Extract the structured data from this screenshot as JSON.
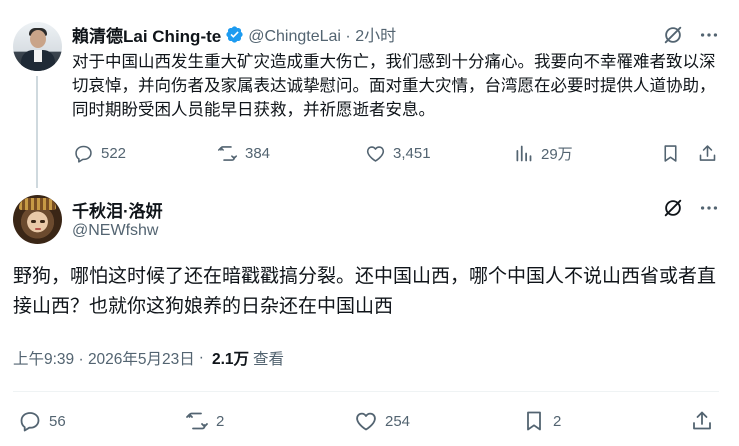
{
  "tweet": {
    "display_name": "賴清德Lai Ching-te",
    "handle": "@ChingteLai",
    "separator": "·",
    "time": "2小时",
    "text": "对于中国山西发生重大矿灾造成重大伤亡，我们感到十分痛心。我要向不幸罹难者致以深切哀悼，并向伤者及家属表达诚挚慰问。面对重大灾情，台湾愿在必要时提供人道协助，同时期盼受困人员能早日获救，并祈愿逝者安息。",
    "replies": "522",
    "reposts": "384",
    "likes": "3,451",
    "views": "29万",
    "verified_color": "#1d9bf0"
  },
  "reply": {
    "display_name": "千秋泪·洛妍",
    "handle": "@NEWfshw",
    "text": "野狗，哪怕这时候了还在暗戳戳搞分裂。还中国山西，哪个中国人不说山西省或者直接山西？也就你这狗娘养的日杂还在中国山西",
    "timestamp": "上午9:39 · 2026年5月23日",
    "views_count": "2.1万",
    "views_label": "查看",
    "dot": "·",
    "replies": "56",
    "reposts": "2",
    "likes": "254",
    "bookmarks": "2"
  },
  "icons": [
    "grok-icon",
    "more-icon",
    "reply-icon",
    "repost-icon",
    "like-icon",
    "views-icon",
    "bookmark-icon",
    "share-icon",
    "verified-badge-icon"
  ],
  "colors": {
    "text": "#0f1419",
    "secondary": "#536471",
    "line": "#cfd9de"
  }
}
